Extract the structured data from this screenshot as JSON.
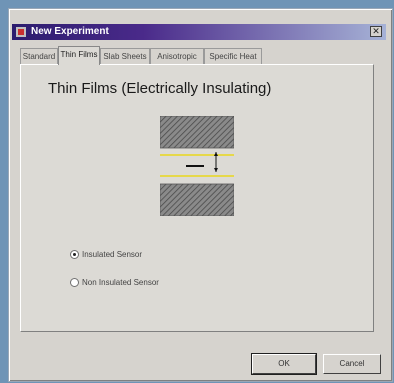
{
  "window": {
    "title": "New Experiment",
    "close_glyph": "✕"
  },
  "tabs": [
    {
      "label": "Standard",
      "active": false
    },
    {
      "label": "Thin Films",
      "active": true
    },
    {
      "label": "Slab Sheets",
      "active": false
    },
    {
      "label": "Anisotropic",
      "active": false
    },
    {
      "label": "Specific Heat",
      "active": false
    }
  ],
  "panel": {
    "heading": "Thin Films (Electrically Insulating)",
    "diagram": {
      "icon": "thin-film-sensor-diagram",
      "accent_color": "#e6d84a"
    }
  },
  "options": [
    {
      "label": "Insulated Sensor",
      "checked": true
    },
    {
      "label": "Non Insulated Sensor",
      "checked": false
    }
  ],
  "buttons": {
    "ok": "OK",
    "cancel": "Cancel"
  }
}
